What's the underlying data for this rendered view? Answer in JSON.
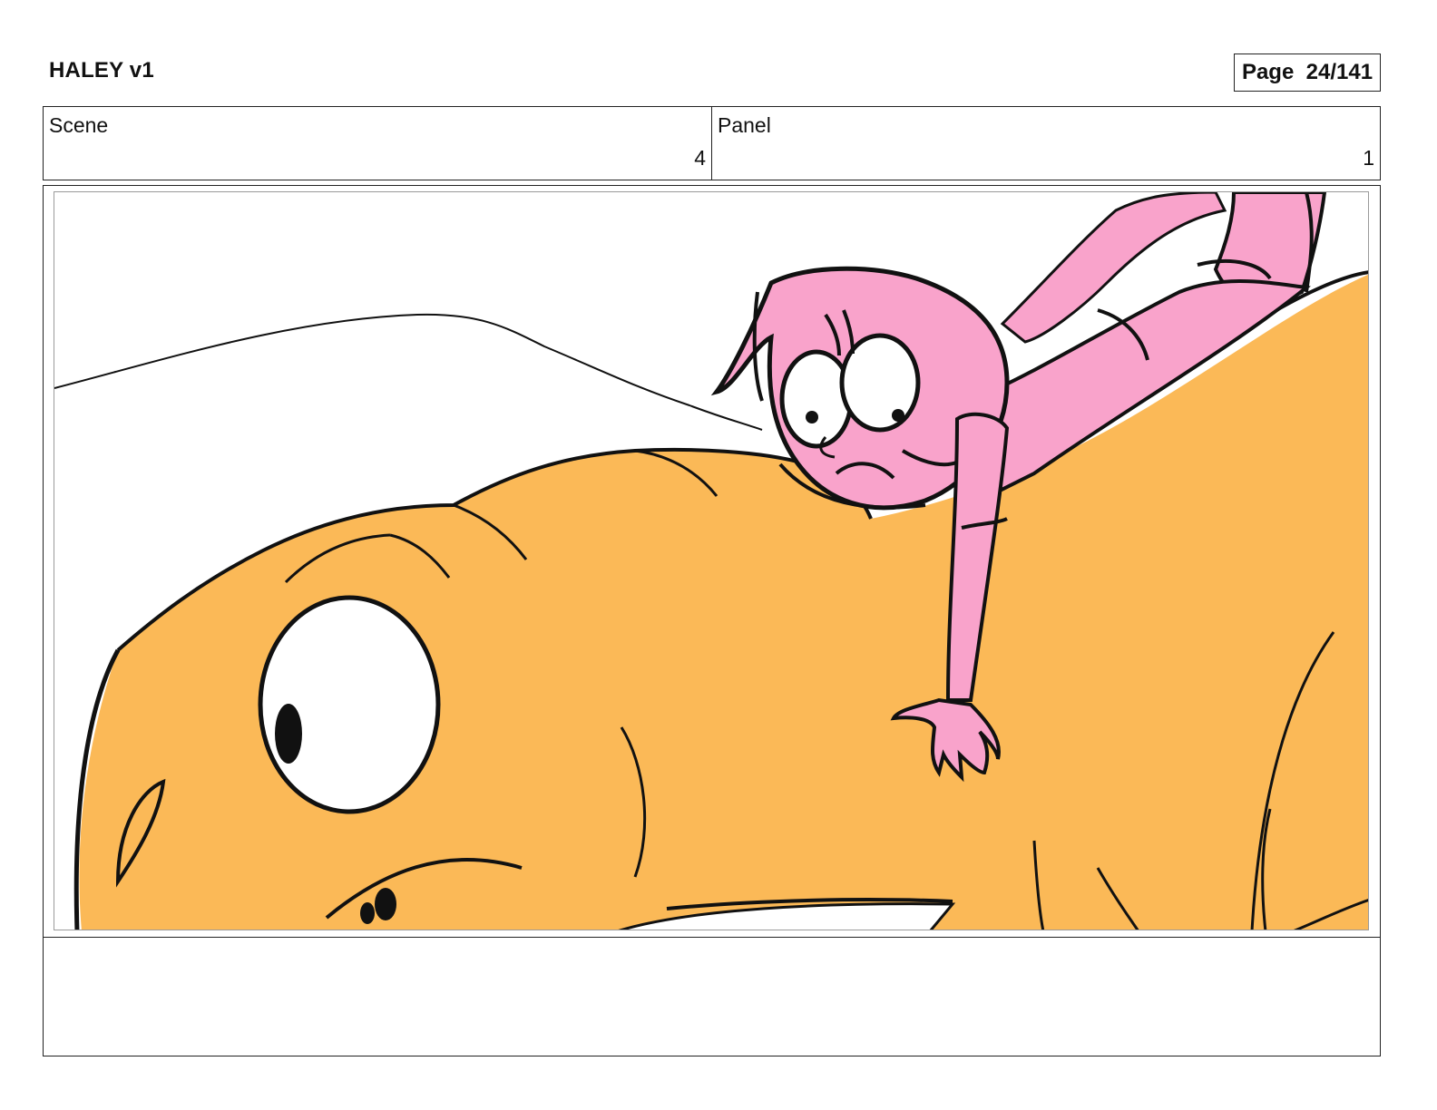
{
  "header": {
    "title": "HALEY v1",
    "page_label": "Page  24/141"
  },
  "info": {
    "scene_label": "Scene",
    "scene_value": "4",
    "panel_label": "Panel",
    "panel_value": "1"
  },
  "notes": {
    "text": ""
  },
  "colors": {
    "creature_orange": "#FBB957",
    "character_pink": "#F9A3CB",
    "line": "#111111"
  }
}
